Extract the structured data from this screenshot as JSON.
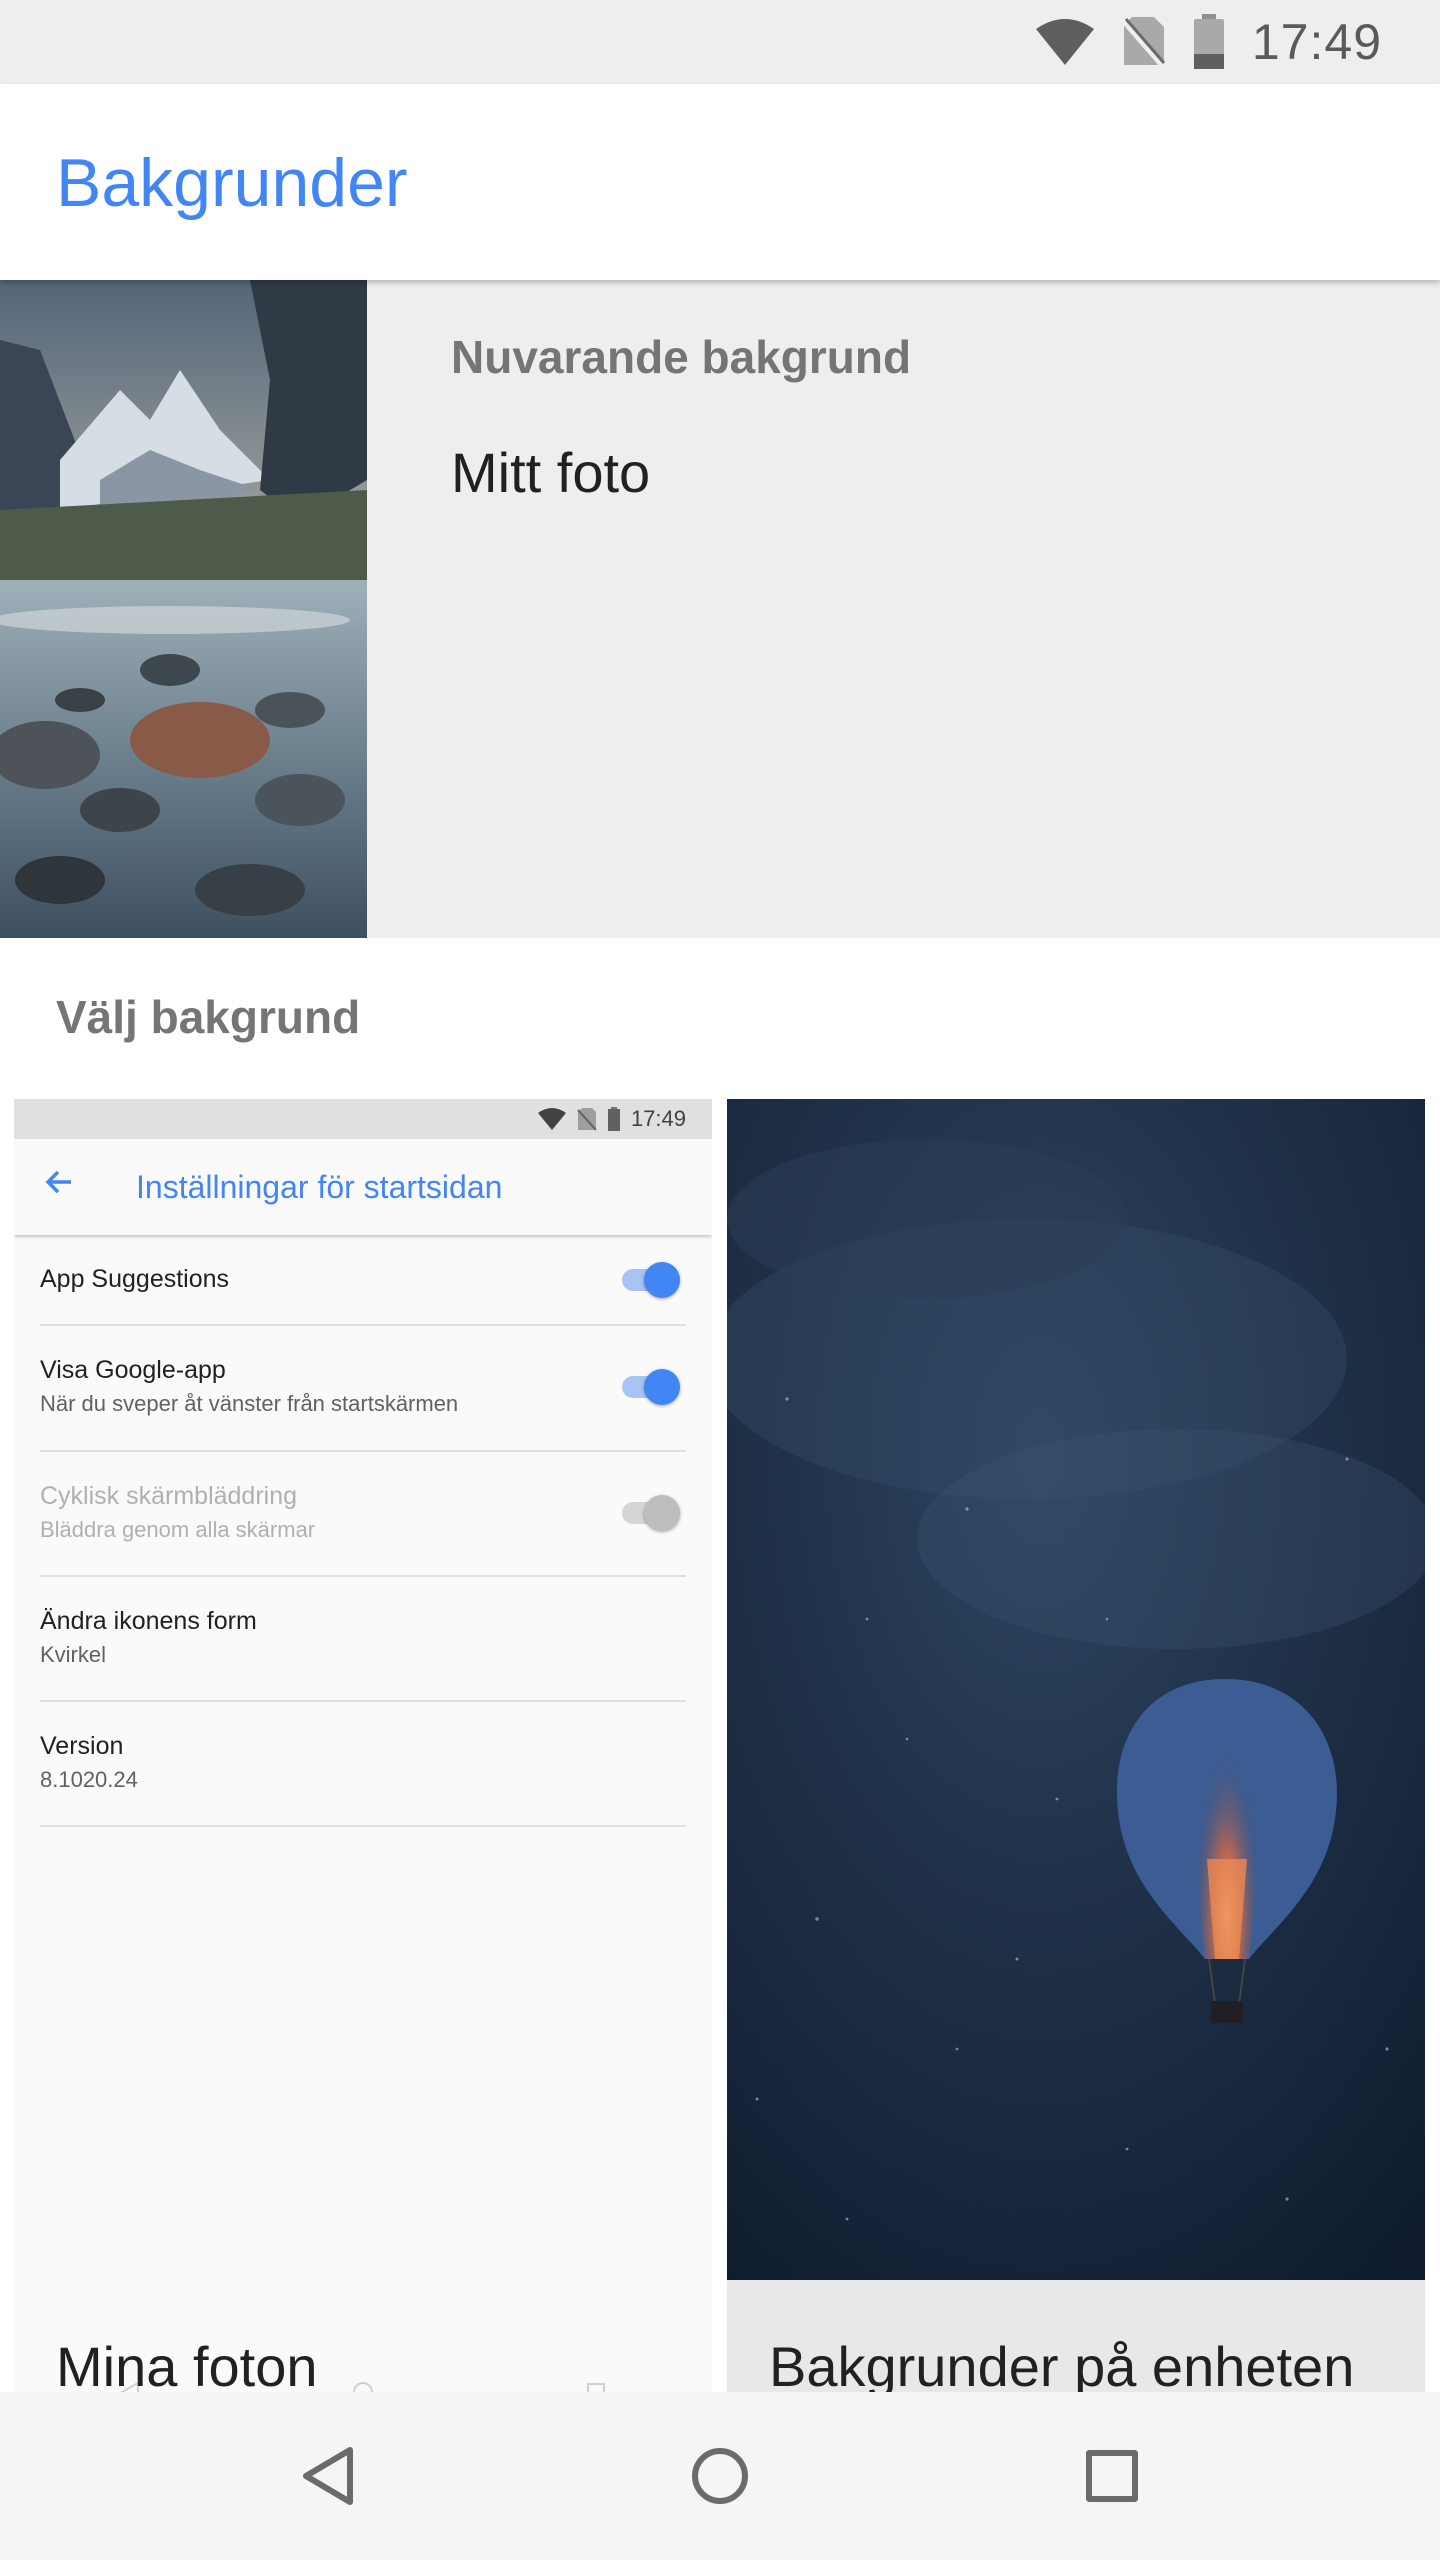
{
  "status_bar": {
    "time": "17:49"
  },
  "app_bar": {
    "title": "Bakgrunder"
  },
  "current_wallpaper": {
    "label": "Nuvarande bakgrund",
    "name": "Mitt foto"
  },
  "choose": {
    "label": "Välj bakgrund",
    "tiles": [
      {
        "caption": "Mina foton"
      },
      {
        "caption": "Bakgrunder på enheten"
      }
    ]
  },
  "preview_screen": {
    "time": "17:49",
    "title": "Inställningar för startsidan",
    "rows": [
      {
        "title": "App Suggestions",
        "subtitle": "",
        "toggle": "on"
      },
      {
        "title": "Visa Google-app",
        "subtitle": "När du sveper åt vänster från startskärmen",
        "toggle": "on"
      },
      {
        "title": "Cyklisk skärmbläddring",
        "subtitle": "Bläddra genom alla skärmar",
        "toggle": "disabled"
      },
      {
        "title": "Ändra ikonens form",
        "subtitle": "Kvirkel"
      },
      {
        "title": "Version",
        "subtitle": "8.1020.24"
      }
    ]
  },
  "nav_bar": {
    "icons": [
      "back-icon",
      "home-icon",
      "recents-icon"
    ]
  },
  "colors": {
    "accent": "#4285f4",
    "status_bar": "#eeeeee"
  }
}
